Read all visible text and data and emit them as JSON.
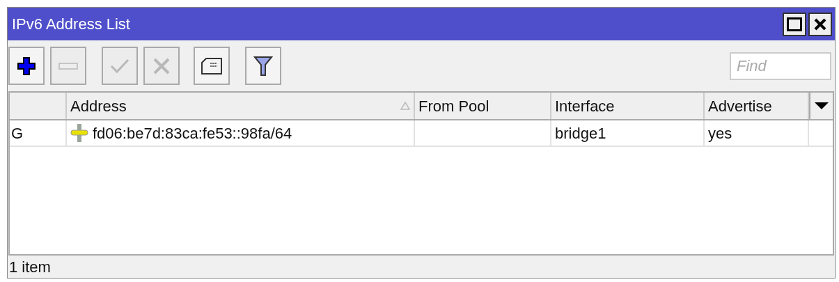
{
  "window": {
    "title": "IPv6 Address List"
  },
  "toolbar": [
    {
      "kind": "add",
      "disabled": false
    },
    {
      "kind": "remove",
      "disabled": true
    },
    {
      "kind": "enable",
      "disabled": true
    },
    {
      "kind": "disable",
      "disabled": true
    },
    {
      "kind": "comment",
      "disabled": false
    },
    {
      "kind": "filter",
      "disabled": false
    }
  ],
  "search": {
    "placeholder": "Find"
  },
  "table": {
    "columns": [
      "",
      "Address",
      "From Pool",
      "Interface",
      "Advertise"
    ],
    "rows": [
      {
        "flags": "G",
        "address": "fd06:be7d:83ca:fe53::98fa/64",
        "from_pool": "",
        "interface": "bridge1",
        "advertise": "yes"
      }
    ]
  },
  "status_bar": "1 item"
}
